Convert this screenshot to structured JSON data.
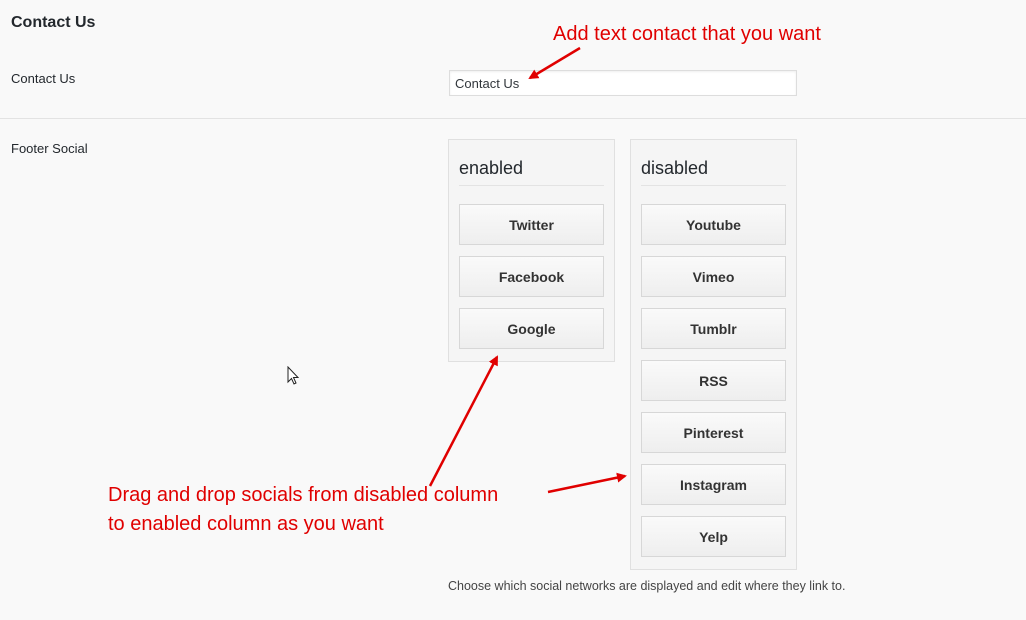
{
  "section": {
    "title": "Contact Us"
  },
  "contact_row": {
    "label": "Contact Us",
    "input_value": "Contact Us"
  },
  "footer_social": {
    "label": "Footer Social",
    "enabled": {
      "heading": "enabled",
      "items": [
        "Twitter",
        "Facebook",
        "Google"
      ]
    },
    "disabled": {
      "heading": "disabled",
      "items": [
        "Youtube",
        "Vimeo",
        "Tumblr",
        "RSS",
        "Pinterest",
        "Instagram",
        "Yelp"
      ]
    },
    "help_text": "Choose which social networks are displayed and edit where they link to."
  },
  "annotations": {
    "top": "Add text contact that you want",
    "bottom_line1": "Drag and drop socials from disabled column",
    "bottom_line2": "to enabled column as you want"
  },
  "colors": {
    "annotation": "#e00000",
    "background": "#f9f9f9"
  },
  "icons": {
    "cursor": "mouse-pointer-icon"
  }
}
